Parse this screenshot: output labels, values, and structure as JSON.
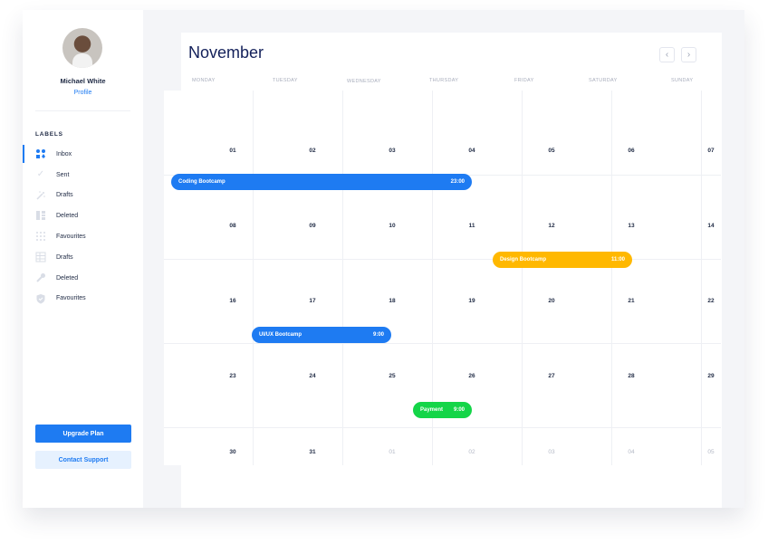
{
  "user": {
    "name": "Michael White",
    "profile_link": "Profile"
  },
  "labels_title": "LABELS",
  "nav": [
    {
      "label": "Inbox",
      "icon": "inbox-icon",
      "active": true
    },
    {
      "label": "Sent",
      "icon": "check-icon"
    },
    {
      "label": "Drafts",
      "icon": "magic-wand-icon"
    },
    {
      "label": "Deleted",
      "icon": "columns-icon"
    },
    {
      "label": "Favourites",
      "icon": "grid-icon"
    },
    {
      "label": "Drafts",
      "icon": "table-icon"
    },
    {
      "label": "Deleted",
      "icon": "wrench-icon"
    },
    {
      "label": "Favourites",
      "icon": "shield-icon"
    }
  ],
  "buttons": {
    "upgrade": "Upgrade Plan",
    "support": "Contact Support"
  },
  "calendar": {
    "month": "November",
    "weekdays": [
      "MONDAY",
      "TUESDAY",
      "WEDNESDAY",
      "THURSDAY",
      "FRIDAY",
      "SATURDAY",
      "SUNDAY"
    ],
    "weeks": [
      [
        "01",
        "02",
        "03",
        "04",
        "05",
        "06",
        "07"
      ],
      [
        "08",
        "09",
        "10",
        "11",
        "12",
        "13",
        "14"
      ],
      [
        "16",
        "17",
        "18",
        "19",
        "20",
        "21",
        "22"
      ],
      [
        "23",
        "24",
        "25",
        "26",
        "27",
        "28",
        "29"
      ],
      [
        "30",
        "31",
        "01",
        "02",
        "03",
        "04",
        "05"
      ]
    ],
    "muted_last_week_from": 2,
    "events": [
      {
        "title": "Coding Bootcamp",
        "time": "23:00",
        "color": "#1e7bf2"
      },
      {
        "title": "Design Bootcamp",
        "time": "11:00",
        "color": "#ffb800"
      },
      {
        "title": "UI/UX Bootcamp",
        "time": "9:00",
        "color": "#1e7bf2"
      },
      {
        "title": "Payment",
        "time": "9:00",
        "color": "#14d548"
      }
    ]
  },
  "colors": {
    "accent": "#1e7bf2",
    "title": "#13205a"
  }
}
